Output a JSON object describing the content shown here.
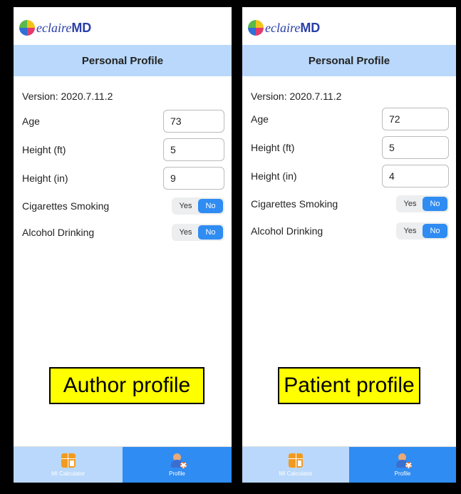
{
  "app": {
    "logo_script": "eclaire",
    "logo_bold": "MD",
    "title": "Personal Profile",
    "version": "Version: 2020.7.11.2"
  },
  "labels": {
    "age": "Age",
    "height_ft": "Height (ft)",
    "height_in": "Height (in)",
    "smoking": "Cigarettes Smoking",
    "drinking": "Alcohol Drinking",
    "yes": "Yes",
    "no": "No"
  },
  "left": {
    "age": "73",
    "height_ft": "5",
    "height_in": "9",
    "smoking_selected": "No",
    "drinking_selected": "No",
    "caption": "Author profile"
  },
  "right": {
    "age": "72",
    "height_ft": "5",
    "height_in": "4",
    "smoking_selected": "No",
    "drinking_selected": "No",
    "caption": "Patient profile"
  },
  "tabs": {
    "calculator": "MI Calculator",
    "profile": "Profile",
    "active": "Profile"
  },
  "colors": {
    "header_bg": "#b9d8fb",
    "accent": "#2f8cf2",
    "caption_bg": "#ffff00",
    "logo_text": "#2a3fa8"
  }
}
